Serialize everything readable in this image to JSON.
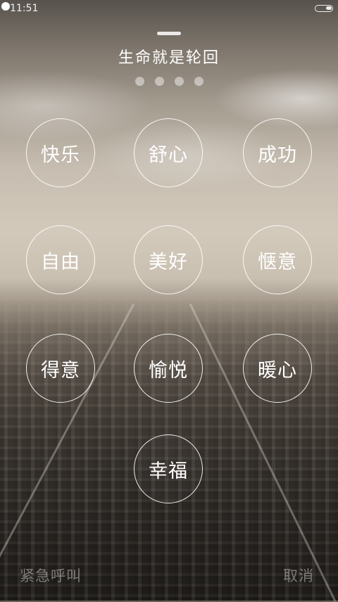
{
  "status_bar": {
    "time": "11:51",
    "icons": [
      "notification-dot-icon",
      "battery-icon"
    ]
  },
  "header": {
    "title": "生命就是轮回",
    "page_dots": 4
  },
  "word_circles": [
    "快乐",
    "舒心",
    "成功",
    "自由",
    "美好",
    "惬意",
    "得意",
    "愉悦",
    "暖心",
    "幸福"
  ],
  "footer": {
    "emergency_label": "紧急呼叫",
    "cancel_label": "取消"
  },
  "colors": {
    "text": "#ffffff",
    "circle_border": "#ffffff",
    "footer_text": "#e6e6e6"
  }
}
